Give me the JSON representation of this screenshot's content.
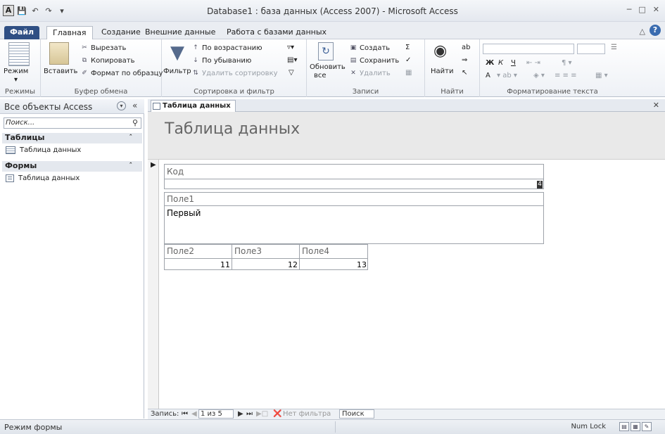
{
  "window": {
    "title": "Database1 : база данных (Access 2007)  -  Microsoft Access",
    "app_icon": "A"
  },
  "ribbon_tabs": [
    "Файл",
    "Главная",
    "Создание",
    "Внешние данные",
    "Работа с базами данных"
  ],
  "ribbon": {
    "views": {
      "mode": "Режим",
      "label": "Режимы"
    },
    "clipboard": {
      "paste": "Вставить",
      "cut": "Вырезать",
      "copy": "Копировать",
      "format_painter": "Формат по образцу",
      "label": "Буфер обмена"
    },
    "sort_filter": {
      "filter": "Фильтр",
      "ascending": "По возрастанию",
      "descending": "По убыванию",
      "remove_sort": "Удалить сортировку",
      "label": "Сортировка и фильтр"
    },
    "records": {
      "refresh": "Обновить",
      "refresh2": "все",
      "new": "Создать",
      "save": "Сохранить",
      "delete": "Удалить",
      "label": "Записи"
    },
    "find": {
      "find": "Найти",
      "label": "Найти"
    },
    "text_format": {
      "bold": "Ж",
      "italic": "К",
      "underline": "Ч",
      "font_color": "A",
      "label": "Форматирование текста"
    }
  },
  "nav_pane": {
    "title": "Все объекты Access",
    "search_placeholder": "Поиск...",
    "sections": [
      {
        "name": "Таблицы",
        "items": [
          "Таблица данных"
        ]
      },
      {
        "name": "Формы",
        "items": [
          "Таблица данных"
        ]
      }
    ]
  },
  "document": {
    "tab_label": "Таблица данных",
    "form_title": "Таблица данных",
    "fields": {
      "kod_label": "Код",
      "kod_value": "4",
      "pole1_label": "Поле1",
      "pole1_value": "Первый",
      "pole2_label": "Поле2",
      "pole3_label": "Поле3",
      "pole4_label": "Поле4",
      "pole2_value": "11",
      "pole3_value": "12",
      "pole4_value": "13"
    }
  },
  "record_nav": {
    "label": "Запись:",
    "position": "1 из 5",
    "filter": "Нет фильтра",
    "search": "Поиск"
  },
  "status": {
    "left": "Режим формы",
    "num_lock": "Num Lock"
  }
}
